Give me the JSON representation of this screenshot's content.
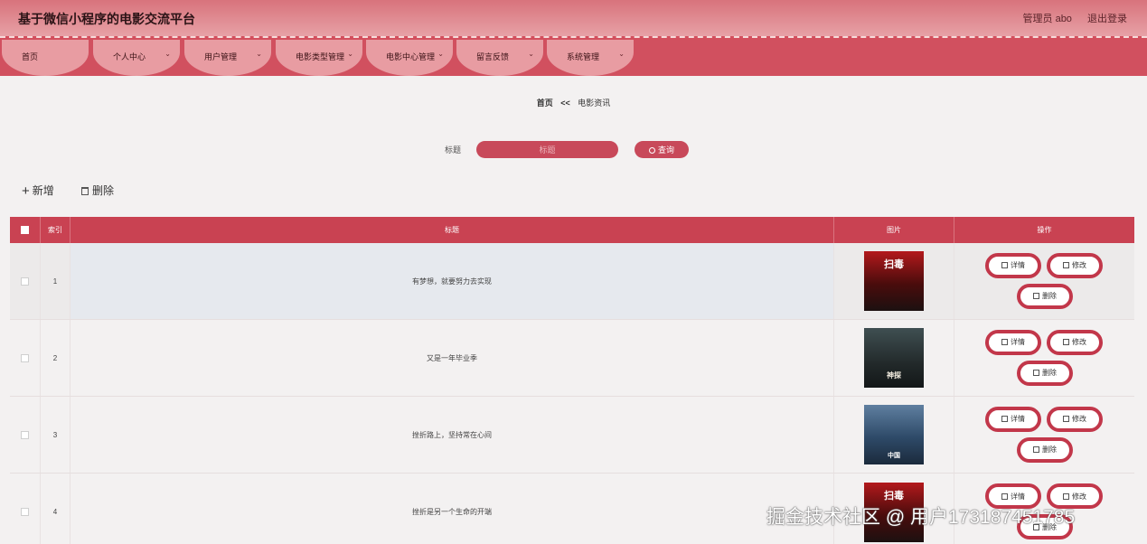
{
  "header": {
    "title": "基于微信小程序的电影交流平台",
    "user": "管理员 abo",
    "logout": "退出登录"
  },
  "nav": [
    {
      "label": "首页",
      "has_dropdown": false
    },
    {
      "label": "个人中心",
      "has_dropdown": true
    },
    {
      "label": "用户管理",
      "has_dropdown": true
    },
    {
      "label": "电影类型管理",
      "has_dropdown": true
    },
    {
      "label": "电影中心管理",
      "has_dropdown": true
    },
    {
      "label": "留言反馈",
      "has_dropdown": true
    },
    {
      "label": "系统管理",
      "has_dropdown": true
    }
  ],
  "breadcrumb": {
    "home": "首页",
    "sep": "<<",
    "current": "电影资讯"
  },
  "search": {
    "label": "标题",
    "placeholder": "标题",
    "button": "查询"
  },
  "toolbar": {
    "add": "新增",
    "delete": "删除"
  },
  "table": {
    "columns": {
      "index": "索引",
      "title": "标题",
      "image": "图片",
      "actions": "操作"
    },
    "rows": [
      {
        "index": "1",
        "title": "有梦想，就要努力去实现"
      },
      {
        "index": "2",
        "title": "又是一年毕业季"
      },
      {
        "index": "3",
        "title": "挫折路上，坚持常在心间"
      },
      {
        "index": "4",
        "title": "挫折是另一个生命的开端"
      }
    ],
    "actions": {
      "detail": "详情",
      "edit": "修改",
      "delete": "删除"
    }
  },
  "watermark": "掘金技术社区 @ 用户1731874517​85"
}
